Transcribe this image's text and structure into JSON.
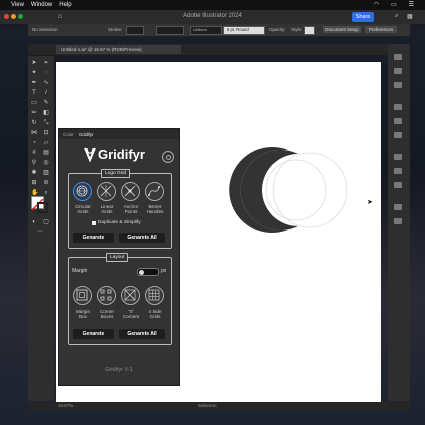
{
  "menubar": {
    "items": [
      "",
      "View",
      "Window",
      "Help"
    ]
  },
  "window": {
    "title": "Adobe Illustrator 2024",
    "share_label": "Share"
  },
  "controlbar": {
    "selection": "No Selection",
    "stroke_label": "Stroke:",
    "stroke_value": "",
    "uniform_label": "Uniform",
    "brush_label": "5 pt. Round",
    "opacity_label": "Opacity:",
    "style_label": "Style:",
    "document_setup": "Document Setup",
    "preferences": "Preferences"
  },
  "document_tab": {
    "label": "Untitled-1.ai* @ 16.67 % (RGB/Preview)"
  },
  "statusbar": {
    "zoom": "16.67%",
    "mode": "Selection"
  },
  "panel": {
    "tabs": [
      "Color",
      "Gridifyr"
    ],
    "logo_text": "Gridifyr",
    "logo_grid": {
      "title": "Logo Grid",
      "options": [
        {
          "label_line1": "Circular",
          "label_line2": "Grids",
          "icon": "circular-grids-icon"
        },
        {
          "label_line1": "Linear",
          "label_line2": "Grids",
          "icon": "linear-grids-icon"
        },
        {
          "label_line1": "Anchor",
          "label_line2": "Points",
          "icon": "anchor-points-icon"
        },
        {
          "label_line1": "Bezier",
          "label_line2": "Handles",
          "icon": "bezier-handles-icon"
        }
      ],
      "checkbox_label": "Duplicate & Simplify",
      "generate_label": "Genarete",
      "generate_all_label": "Genarete All"
    },
    "layout": {
      "title": "Layout",
      "margin_label": "Margin",
      "margin_value": "0",
      "margin_unit": "px",
      "options": [
        {
          "label_line1": "Margin",
          "label_line2": "Box",
          "icon": "margin-box-icon"
        },
        {
          "label_line1": "Corner",
          "label_line2": "Boxes",
          "icon": "corner-boxes-icon"
        },
        {
          "label_line1": "\"X\"",
          "label_line2": "Corners",
          "icon": "x-corners-icon"
        },
        {
          "label_line1": "4 Side",
          "label_line2": "Grids",
          "icon": "four-side-grids-icon"
        }
      ],
      "generate_label": "Genarete",
      "generate_all_label": "Genarete All"
    },
    "footer": "Gridifyr V-1"
  },
  "colors": {
    "accent": "#3a8ef0",
    "share": "#2f6fe0",
    "shape": "#333333"
  }
}
